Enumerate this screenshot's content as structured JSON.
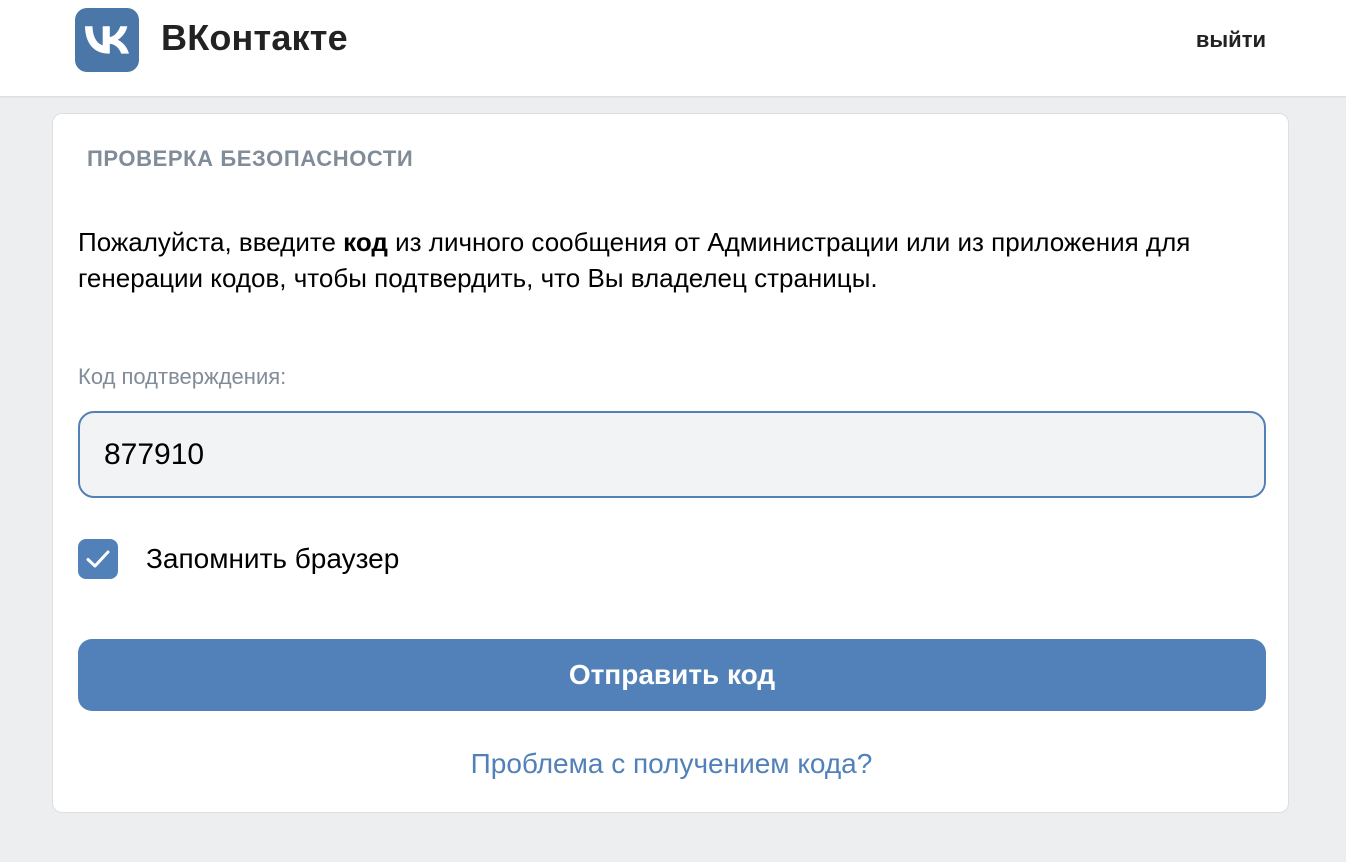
{
  "header": {
    "logo_icon": "vk-logo-icon",
    "brand_name": "ВКонтакте",
    "logout_label": "выйти"
  },
  "security_check": {
    "title": "ПРОВЕРКА БЕЗОПАСНОСТИ",
    "message_part1": "Пожалуйста, введите ",
    "message_bold": "код",
    "message_part2": " из личного сообщения от Администрации или из приложения для генерации кодов, чтобы подтвердить, что Вы владелец страницы.",
    "code_label": "Код подтверждения:",
    "code_value": "877910",
    "remember_label": "Запомнить браузер",
    "remember_checked": true,
    "checkbox_icon": "checkmark-icon",
    "submit_label": "Отправить код",
    "problem_link": "Проблема с получением кода?"
  },
  "colors": {
    "accent": "#5181b8",
    "page_background": "#edeef0",
    "muted_text": "#818c99"
  }
}
